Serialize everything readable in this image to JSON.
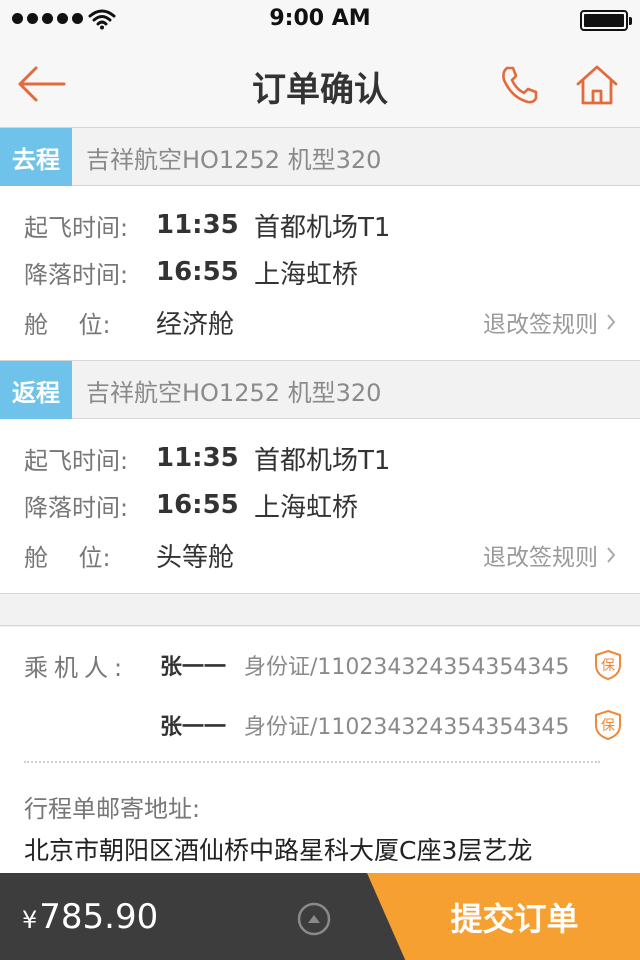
{
  "status_bar": {
    "time": "9:00 AM"
  },
  "nav": {
    "title": "订单确认"
  },
  "outbound": {
    "tag": "去程",
    "flight": "吉祥航空HO1252  机型320",
    "depart_label": "起飞时间:",
    "depart_time": "11:35",
    "depart_place": "首都机场T1",
    "arrive_label": "降落时间:",
    "arrive_time": "16:55",
    "arrive_place": "上海虹桥",
    "cabin_label": "舱    位:",
    "cabin": "经济舱",
    "rules": "退改签规则"
  },
  "return": {
    "tag": "返程",
    "flight": "吉祥航空HO1252  机型320",
    "depart_label": "起飞时间:",
    "depart_time": "11:35",
    "depart_place": "首都机场T1",
    "arrive_label": "降落时间:",
    "arrive_time": "16:55",
    "arrive_place": "上海虹桥",
    "cabin_label": "舱    位:",
    "cabin": "头等舱",
    "rules": "退改签规则"
  },
  "passengers": {
    "label": "乘机人:",
    "items": [
      {
        "name": "张一一",
        "id": "身份证/110234324354354345",
        "badge": "保"
      },
      {
        "name": "张一一",
        "id": "身份证/110234324354354345",
        "badge": "保"
      }
    ],
    "address_label": "行程单邮寄地址:",
    "address": "北京市朝阳区酒仙桥中路星科大厦C座3层艺龙"
  },
  "footer": {
    "currency": "¥",
    "price": "785.90",
    "submit_label": "提交订单"
  },
  "colors": {
    "accent_orange": "#f6a032",
    "icon_orange": "#e36a3a",
    "tag_blue": "#6fc3ea",
    "bottom_bar": "#3d3d3d"
  }
}
